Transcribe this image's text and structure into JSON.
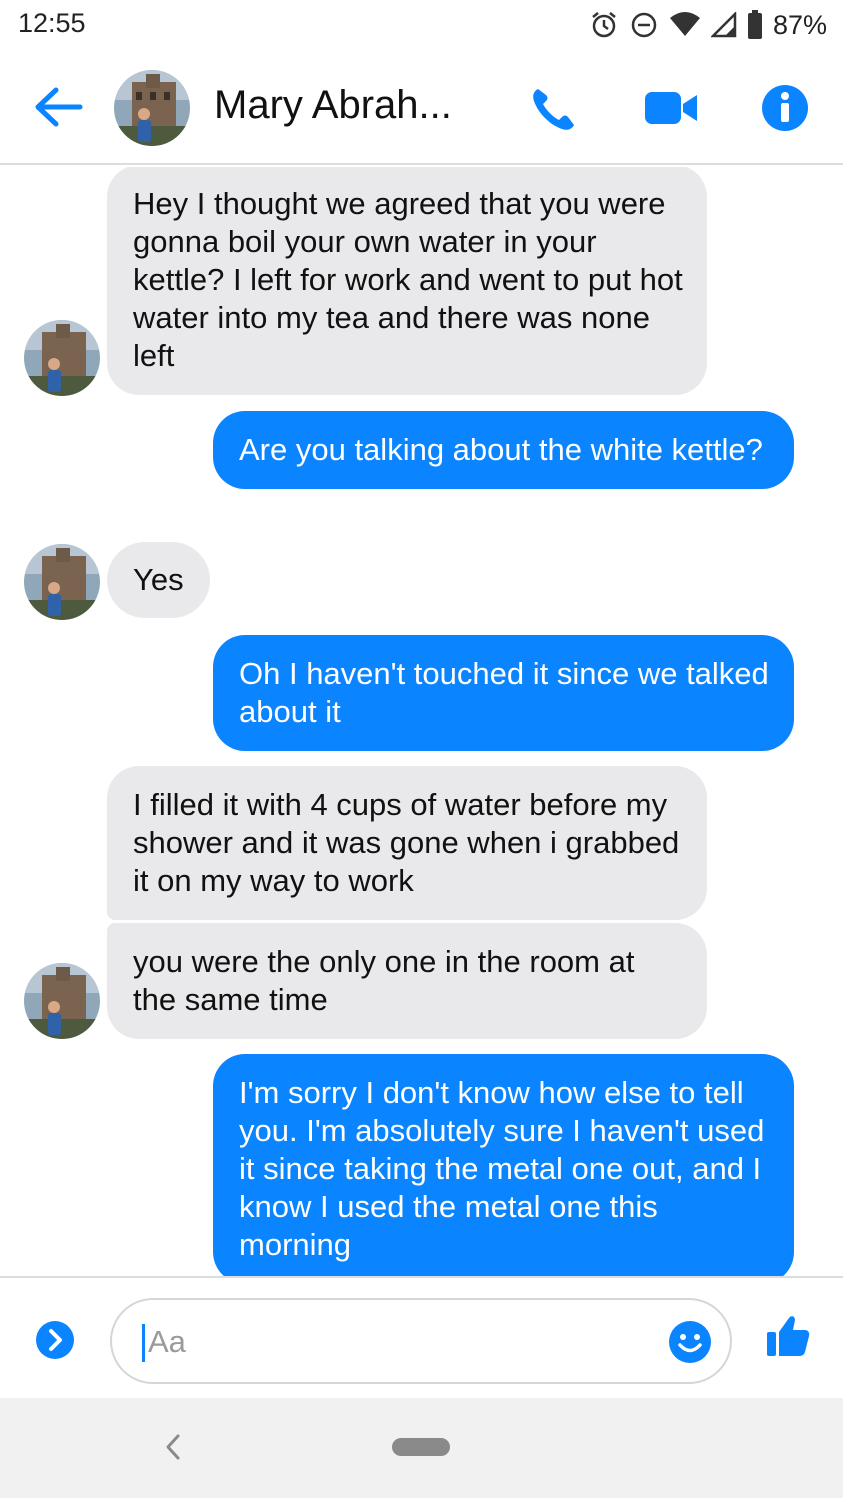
{
  "status_bar": {
    "time": "12:55",
    "battery_percent": "87%",
    "icons": [
      "alarm-icon",
      "do-not-disturb-icon",
      "wifi-icon",
      "signal-icon",
      "battery-icon"
    ]
  },
  "header": {
    "contact_name": "Mary Abrah...",
    "icons": [
      "back-arrow-icon",
      "phone-icon",
      "video-camera-icon",
      "info-icon"
    ],
    "accent_color": "#0a84ff"
  },
  "messages": [
    {
      "direction": "incoming",
      "text": "Hey I thought we agreed that you were gonna boil your own water in your kettle? I left for work and went to put hot water into my tea and there was none left"
    },
    {
      "direction": "outgoing",
      "text": "Are you talking about the white kettle?"
    },
    {
      "direction": "incoming",
      "text": "Yes"
    },
    {
      "direction": "outgoing",
      "text": "Oh I haven't touched it since we talked about it"
    },
    {
      "direction": "incoming",
      "text": "I filled it with 4 cups of water before my shower and it was gone when i grabbed it on my way to work"
    },
    {
      "direction": "incoming",
      "text": "you were the only one in the room at the same time"
    },
    {
      "direction": "outgoing",
      "text": "I'm sorry I don't know how else to tell you. I'm absolutely sure I haven't used it since taking the metal one out, and I know I used the metal one this morning"
    }
  ],
  "composer": {
    "placeholder": "Aa",
    "value": "",
    "icons": [
      "expand-chevron-icon",
      "emoji-icon",
      "thumbs-up-icon"
    ]
  },
  "navbar": {
    "icons": [
      "nav-back-icon",
      "home-pill-icon"
    ]
  },
  "colors": {
    "incoming_bubble": "#e9e9eb",
    "outgoing_bubble": "#0a84ff"
  }
}
